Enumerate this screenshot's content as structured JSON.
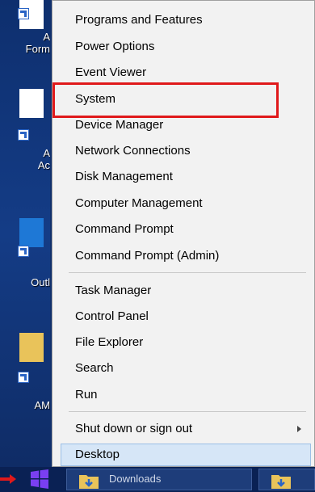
{
  "desktop": {
    "icons": [
      {
        "label": "A\nForm"
      },
      {
        "label": "A\nAc"
      },
      {
        "label": "Outl"
      },
      {
        "label": "AM"
      }
    ]
  },
  "menu": {
    "group1": [
      "Programs and Features",
      "Power Options",
      "Event Viewer",
      "System",
      "Device Manager",
      "Network Connections",
      "Disk Management",
      "Computer Management",
      "Command Prompt",
      "Command Prompt (Admin)"
    ],
    "group2": [
      "Task Manager",
      "Control Panel",
      "File Explorer",
      "Search",
      "Run"
    ],
    "shutdown": "Shut down or sign out",
    "desktop": "Desktop",
    "highlight_color": "#e0191b"
  },
  "taskbar": {
    "item1_label": "Downloads"
  }
}
